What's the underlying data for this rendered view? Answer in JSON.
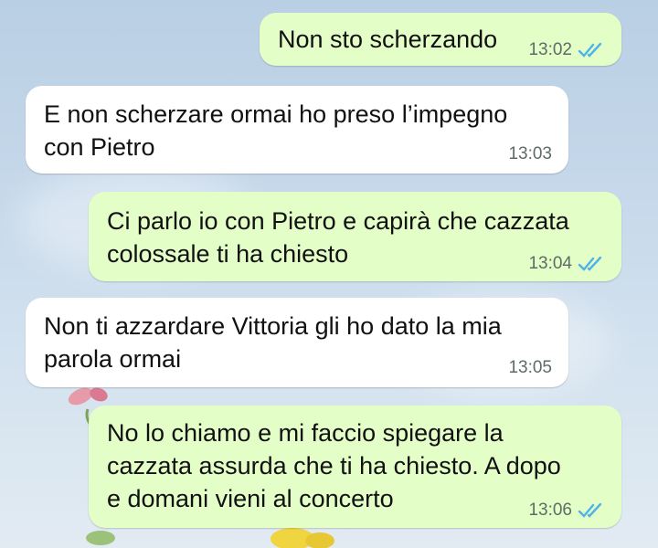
{
  "chat": {
    "messages": [
      {
        "direction": "outgoing",
        "text": "Non sto scherzando",
        "time": "13:02",
        "status": "read"
      },
      {
        "direction": "incoming",
        "text": "E non scherzare ormai ho preso l’impegno\ncon Pietro",
        "time": "13:03"
      },
      {
        "direction": "outgoing",
        "text": "Ci parlo io con Pietro e capirà che cazzata\ncolossale ti ha chiesto",
        "time": "13:04",
        "status": "read"
      },
      {
        "direction": "incoming",
        "text": "Non ti azzardare Vittoria gli ho dato la mia\nparola ormai",
        "time": "13:05"
      },
      {
        "direction": "outgoing",
        "text": "No lo chiamo e mi faccio spiegare la\ncazzata assurda che ti ha chiesto. A dopo\ne domani vieni al concerto",
        "time": "13:06",
        "status": "read"
      }
    ]
  },
  "colors": {
    "outgoing_bubble": "#e4fec8",
    "incoming_bubble": "#ffffff",
    "read_check": "#4fb3e8",
    "timestamp": "#5f6b66"
  },
  "icons": {
    "read_receipt": "double-check-icon"
  }
}
